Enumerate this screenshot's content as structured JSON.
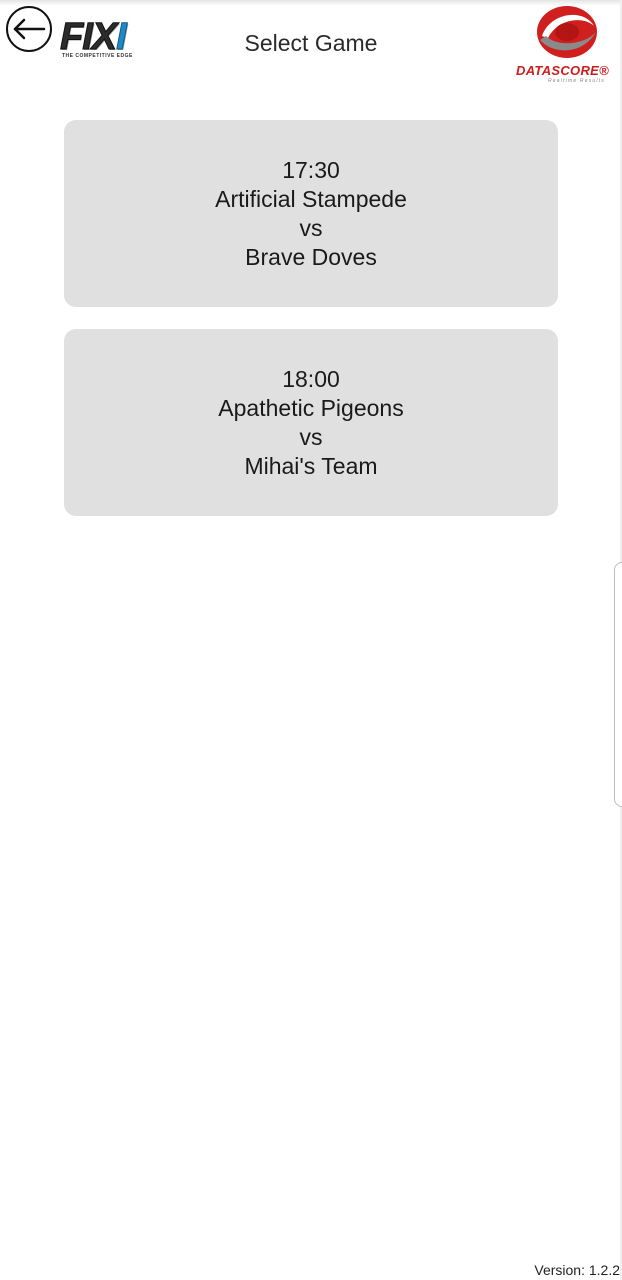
{
  "header": {
    "title": "Select Game",
    "back_icon": "arrow-left-icon",
    "left_logo": {
      "text_main": "FIX",
      "text_accent": "I",
      "tagline": "THE COMPETITIVE EDGE"
    },
    "right_logo": {
      "text": "DATASCORE®",
      "tagline": "Realtime Results",
      "brand_color": "#cc1d1d"
    }
  },
  "games": [
    {
      "time": "17:30",
      "home": "Artificial Stampede",
      "separator": "vs",
      "away": "Brave Doves"
    },
    {
      "time": "18:00",
      "home": "Apathetic Pigeons",
      "separator": "vs",
      "away": "Mihai's Team"
    }
  ],
  "footer": {
    "version": "Version: 1.2.2"
  },
  "colors": {
    "card_background": "#e0e0e0",
    "fixi_accent": "#1e88c8"
  }
}
